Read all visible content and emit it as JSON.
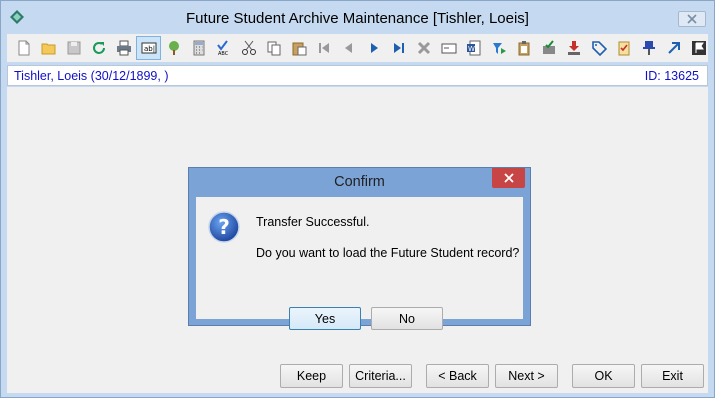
{
  "window": {
    "title": "Future Student Archive Maintenance  [Tishler, Loeis]",
    "close_icon": "close-icon"
  },
  "toolbar": {
    "icons": [
      "new-document-icon",
      "open-folder-icon",
      "save-icon",
      "refresh-icon",
      "print-icon",
      "text-field-icon",
      "tree-icon",
      "calculator-icon",
      "spellcheck-icon",
      "cut-icon",
      "copy-icon",
      "paste-icon",
      "first-record-icon",
      "previous-record-icon",
      "next-record-icon",
      "last-record-icon",
      "delete-icon",
      "card-icon",
      "word-document-icon",
      "filter-icon",
      "clipboard-icon",
      "approve-icon",
      "download-icon",
      "tag-icon",
      "checklist-icon",
      "pin-icon",
      "arrow-up-right-icon",
      "flag-icon"
    ]
  },
  "record": {
    "name": "Tishler, Loeis (30/12/1899, )",
    "id": "ID: 13625"
  },
  "buttons": {
    "keep": "Keep",
    "criteria": "Criteria...",
    "back": "< Back",
    "next": "Next >",
    "ok": "OK",
    "exit": "Exit"
  },
  "dialog": {
    "title": "Confirm",
    "message1": "Transfer Successful.",
    "message2": "Do you want to load the Future Student record?",
    "yes": "Yes",
    "no": "No"
  },
  "colors": {
    "record_text": "#1010c8",
    "dialog_frame": "#7ba3d6",
    "dialog_close": "#c74545"
  }
}
